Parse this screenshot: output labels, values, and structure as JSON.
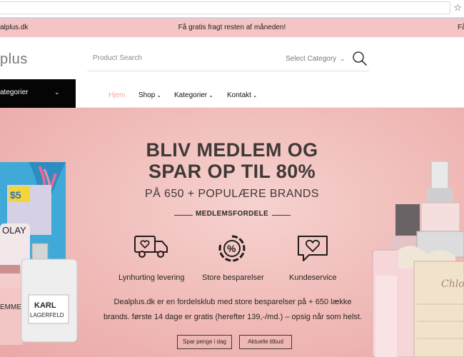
{
  "announcement": {
    "left_text": "alplus.dk",
    "center_text": "Få gratis fragt resten af måneden!",
    "right_text": "Få"
  },
  "header": {
    "logo_text": "plus",
    "search": {
      "placeholder": "Product Search",
      "category_label": "Select Category"
    }
  },
  "nav": {
    "categories_button": "ategorier",
    "items": [
      {
        "label": "Hjem",
        "active": true
      },
      {
        "label": "Shop",
        "dropdown": true
      },
      {
        "label": "Kategorier",
        "dropdown": true
      },
      {
        "label": "Kontakt",
        "dropdown": true
      }
    ]
  },
  "hero": {
    "title_line1": "BLIV MEDLEM OG",
    "title_line2": "SPAR OP TIL 80%",
    "subtitle": "PÅ 650 + POPULÆRE BRANDS",
    "members_label": "MEDLEMSFORDELE",
    "features": [
      {
        "icon": "truck-heart-icon",
        "label": "Lynhurting levering"
      },
      {
        "icon": "percent-icon",
        "label": "Store besparelser"
      },
      {
        "icon": "chat-heart-icon",
        "label": "Kundeservice"
      }
    ],
    "description_line1": "Dealplus.dk er en fordelsklub med store besparelser på + 650 lække",
    "description_line2": "brands. første 14 dage er gratis (herefter 139,-/md.) – opsig når som helst.",
    "buttons": [
      "Spar penge i dag",
      "Aktuelle tilbud"
    ],
    "product_texts": {
      "coupon": "$5",
      "olay": "OLAY",
      "karl_line1": "KARL",
      "karl_line2": "LAGERFELD",
      "femme": "EMME",
      "chloe": "Chloé"
    }
  },
  "colors": {
    "announcement_bg": "#f5c4c4",
    "hero_bg": "#f1bebb",
    "nav_active": "#f0a8a4",
    "category_button_bg": "#050505"
  }
}
